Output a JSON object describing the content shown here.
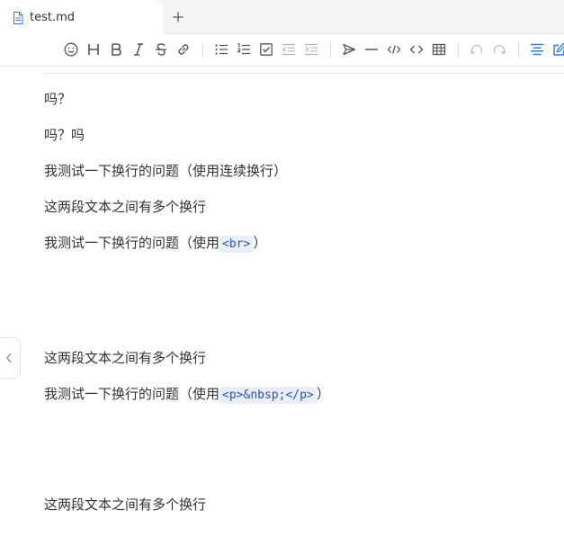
{
  "tab": {
    "title": "test.md",
    "file_icon": "file-doc-icon",
    "new_tab_icon": "plus-icon"
  },
  "toolbar": {
    "items": [
      "emoji-icon",
      "heading-icon",
      "bold-icon",
      "italic-icon",
      "strikethrough-icon",
      "link-icon",
      "bullet-list-icon",
      "ordered-list-icon",
      "checkbox-icon",
      "outdent-icon",
      "indent-icon",
      "quote-icon",
      "horizontal-rule-icon",
      "inline-code-icon",
      "code-block-icon",
      "table-icon",
      "undo-icon",
      "redo-icon",
      "outline-icon",
      "edit-icon"
    ],
    "accent_color": "#2b7de9"
  },
  "document": {
    "p1": "吗？",
    "p2": "吗？吗",
    "p3": "我测试一下换行的问题（使用连续换行）",
    "p4": "这两段文本之间有多个换行",
    "p5_text": "我测试一下换行的问题（使用",
    "p5_code": "<br>",
    "p5_end": "）",
    "p6": "这两段文本之间有多个换行",
    "p7_text": "我测试一下换行的问题（使用",
    "p7_code": "<p>&nbsp;</p>",
    "p7_end": "）",
    "p8": "这两段文本之间有多个换行"
  },
  "sidebar": {
    "collapse_icon": "chevron-left-icon"
  }
}
